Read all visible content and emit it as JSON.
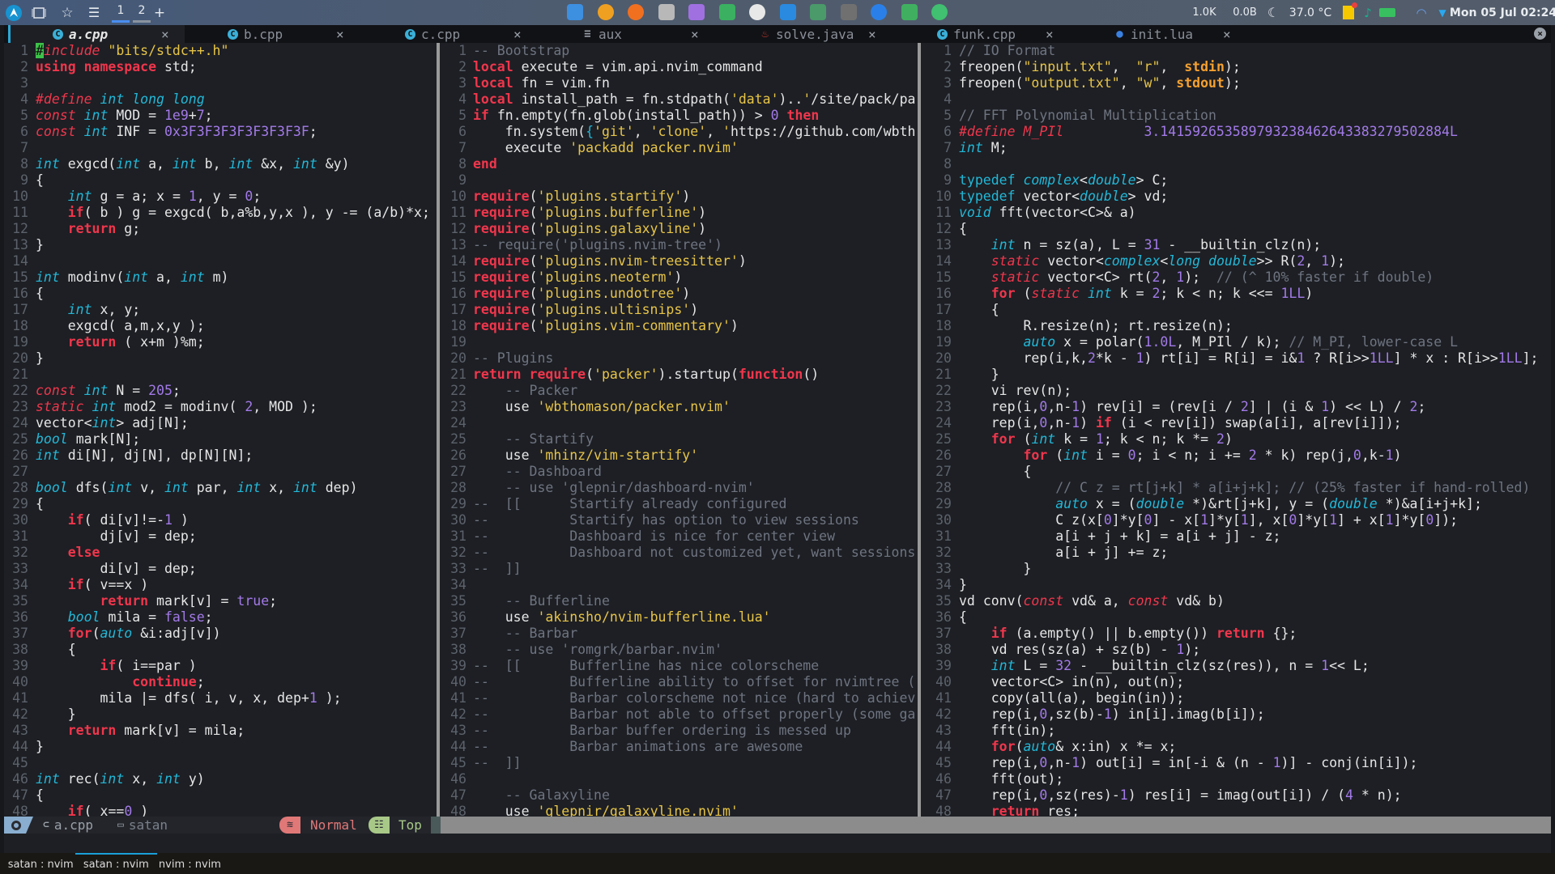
{
  "topbar": {
    "workspaces": [
      {
        "label": "1",
        "active": true
      },
      {
        "label": "2",
        "active": false
      }
    ],
    "add_workspace": "+",
    "apps": [
      "files-icon",
      "brave-icon",
      "firefox-icon",
      "terminal-icon",
      "calculator-icon",
      "vim-icon",
      "neovim-icon",
      "vscode-icon",
      "monitor-icon",
      "settings-icon",
      "qbittorrent-icon",
      "screen-recorder-icon",
      "keepass-icon"
    ],
    "net_up": "1.0K",
    "net_down": "0.0B",
    "temperature": "37.0 °C",
    "clock": "Mon 05 Jul 02:24"
  },
  "tabs": [
    {
      "name": "a.cpp",
      "icon": "c-icon",
      "active": true
    },
    {
      "name": "b.cpp",
      "icon": "c-icon",
      "active": false
    },
    {
      "name": "c.cpp",
      "icon": "c-icon",
      "active": false
    },
    {
      "name": "aux",
      "icon": "file-icon",
      "active": false
    },
    {
      "name": "solve.java",
      "icon": "java-icon",
      "active": false
    },
    {
      "name": "funk.cpp",
      "icon": "c-icon",
      "active": false
    },
    {
      "name": "init.lua",
      "icon": "lua-icon",
      "active": false
    }
  ],
  "tab_close": "×",
  "panes": [
    {
      "lang": "cpp",
      "lines": [
        "#include \"bits/stdc++.h\"",
        "using namespace std;",
        "",
        "#define int long long",
        "const int MOD = 1e9+7;",
        "const int INF = 0x3F3F3F3F3F3F3F3F;",
        "",
        "int exgcd(int a, int b, int &x, int &y)",
        "{",
        "    int g = a; x = 1, y = 0;",
        "    if( b ) g = exgcd( b,a%b,y,x ), y -= (a/b)*x;",
        "    return g;",
        "}",
        "",
        "int modinv(int a, int m)",
        "{",
        "    int x, y;",
        "    exgcd( a,m,x,y );",
        "    return ( x+m )%m;",
        "}",
        "",
        "const int N = 205;",
        "static int mod2 = modinv( 2, MOD );",
        "vector<int> adj[N];",
        "bool mark[N];",
        "int di[N], dj[N], dp[N][N];",
        "",
        "bool dfs(int v, int par, int x, int dep)",
        "{",
        "    if( di[v]!=-1 )",
        "        dj[v] = dep;",
        "    else",
        "        di[v] = dep;",
        "    if( v==x )",
        "        return mark[v] = true;",
        "    bool mila = false;",
        "    for(auto &i:adj[v])",
        "    {",
        "        if( i==par )",
        "            continue;",
        "        mila |= dfs( i, v, x, dep+1 );",
        "    }",
        "    return mark[v] = mila;",
        "}",
        "",
        "int rec(int x, int y)",
        "{",
        "    if( x==0 )"
      ]
    },
    {
      "lang": "lua",
      "lines": [
        "-- Bootstrap",
        "local execute = vim.api.nvim_command",
        "local fn = vim.fn",
        "local install_path = fn.stdpath('data')..'/site/pack/pa",
        "if fn.empty(fn.glob(install_path)) > 0 then",
        "    fn.system({'git', 'clone', 'https://github.com/wbth",
        "    execute 'packadd packer.nvim'",
        "end",
        "",
        "require('plugins.startify')",
        "require('plugins.bufferline')",
        "require('plugins.galaxyline')",
        "-- require('plugins.nvim-tree')",
        "require('plugins.nvim-treesitter')",
        "require('plugins.neoterm')",
        "require('plugins.undotree')",
        "require('plugins.ultisnips')",
        "require('plugins.vim-commentary')",
        "",
        "-- Plugins",
        "return require('packer').startup(function()",
        "    -- Packer",
        "    use 'wbthomason/packer.nvim'",
        "",
        "    -- Startify",
        "    use 'mhinz/vim-startify'",
        "    -- Dashboard",
        "    -- use 'glepnir/dashboard-nvim'",
        "--  [[      Startify already configured",
        "--          Startify has option to view sessions",
        "--          Dashboard is nice for center view",
        "--          Dashboard not customized yet, want sessions",
        "--  ]]",
        "",
        "    -- Bufferline",
        "    use 'akinsho/nvim-bufferline.lua'",
        "    -- Barbar",
        "    -- use 'romgrk/barbar.nvim'",
        "--  [[      Bufferline has nice colorscheme",
        "--          Bufferline ability to offset for nvimtree (",
        "--          Barbar colorscheme not nice (hard to achiev",
        "--          Barbar not able to offset properly (some ga",
        "--          Barbar buffer ordering is messed up",
        "--          Barbar animations are awesome",
        "--  ]]",
        "",
        "    -- Galaxyline",
        "    use 'glepnir/galaxyline.nvim'"
      ]
    },
    {
      "lang": "cpp",
      "lines": [
        "// IO Format",
        "freopen(\"input.txt\",  \"r\",  stdin);",
        "freopen(\"output.txt\", \"w\", stdout);",
        "",
        "// FFT Polynomial Multiplication",
        "#define M_PIl          3.141592653589793238462643383279502884L",
        "int M;",
        "",
        "typedef complex<double> C;",
        "typedef vector<double> vd;",
        "void fft(vector<C>& a)",
        "{",
        "    int n = sz(a), L = 31 - __builtin_clz(n);",
        "    static vector<complex<long double>> R(2, 1);",
        "    static vector<C> rt(2, 1);  // (^ 10% faster if double)",
        "    for (static int k = 2; k < n; k <<= 1LL)",
        "    {",
        "        R.resize(n); rt.resize(n);",
        "        auto x = polar(1.0L, M_PIl / k); // M_PI, lower-case L",
        "        rep(i,k,2*k - 1) rt[i] = R[i] = i&1 ? R[i>>1LL] * x : R[i>>1LL];",
        "    }",
        "    vi rev(n);",
        "    rep(i,0,n-1) rev[i] = (rev[i / 2] | (i & 1) << L) / 2;",
        "    rep(i,0,n-1) if (i < rev[i]) swap(a[i], a[rev[i]]);",
        "    for (int k = 1; k < n; k *= 2)",
        "        for (int i = 0; i < n; i += 2 * k) rep(j,0,k-1)",
        "        {",
        "            // C z = rt[j+k] * a[i+j+k]; // (25% faster if hand-rolled)",
        "            auto x = (double *)&rt[j+k], y = (double *)&a[i+j+k];",
        "            C z(x[0]*y[0] - x[1]*y[1], x[0]*y[1] + x[1]*y[0]);",
        "            a[i + j + k] = a[i + j] - z;",
        "            a[i + j] += z;",
        "        }",
        "}",
        "vd conv(const vd& a, const vd& b)",
        "{",
        "    if (a.empty() || b.empty()) return {};",
        "    vd res(sz(a) + sz(b) - 1);",
        "    int L = 32 - __builtin_clz(sz(res)), n = 1<< L;",
        "    vector<C> in(n), out(n);",
        "    copy(all(a), begin(in));",
        "    rep(i,0,sz(b)-1) in[i].imag(b[i]);",
        "    fft(in);",
        "    for(auto& x:in) x *= x;",
        "    rep(i,0,n-1) out[i] = in[-i & (n - 1)] - conj(in[i]);",
        "    fft(out);",
        "    rep(i,0,sz(res)-1) res[i] = imag(out[i]) / (4 * n);",
        "    return res;"
      ]
    }
  ],
  "statusline": {
    "file": "a.cpp",
    "directory": "satan",
    "mode": "Normal",
    "position": "Top",
    "colors": {
      "mode": "#e07878",
      "position": "#a8c888",
      "blue": "#8aaed0"
    }
  },
  "tmux": {
    "windows": [
      {
        "label": "satan : nvim",
        "active": false
      },
      {
        "label": "satan : nvim",
        "active": true
      },
      {
        "label": "nvim : nvim",
        "active": false
      }
    ]
  }
}
